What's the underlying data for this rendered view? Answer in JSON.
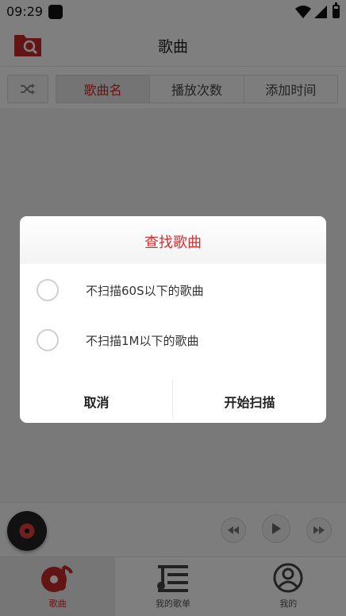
{
  "status_bar": {
    "time": "09:29"
  },
  "header": {
    "title": "歌曲",
    "folder_icon": "folder-search-icon"
  },
  "sort_tabs": [
    {
      "label": "歌曲名",
      "active": true
    },
    {
      "label": "播放次数",
      "active": false
    },
    {
      "label": "添加时间",
      "active": false
    }
  ],
  "player": {
    "disc_icon": "vinyl-disc-icon"
  },
  "bottom_nav": [
    {
      "label": "歌曲",
      "icon": "music-disc-note-icon",
      "active": true
    },
    {
      "label": "我的歌单",
      "icon": "playlist-icon",
      "active": false
    },
    {
      "label": "我的",
      "icon": "user-icon",
      "active": false
    }
  ],
  "dialog": {
    "title": "查找歌曲",
    "options": [
      {
        "label": "不扫描60S以下的歌曲",
        "checked": false
      },
      {
        "label": "不扫描1M以下的歌曲",
        "checked": false
      }
    ],
    "cancel_label": "取消",
    "confirm_label": "开始扫描"
  },
  "colors": {
    "accent": "#d32f2f",
    "overlay": "rgba(0,0,0,0.5)"
  }
}
